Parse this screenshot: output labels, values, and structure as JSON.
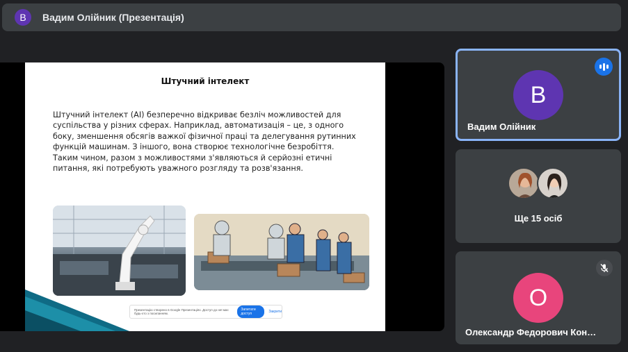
{
  "header": {
    "avatar_letter": "В",
    "title": "Вадим Олійник (Презентація)"
  },
  "slide": {
    "title": "Штучний інтелект",
    "body": "Штучний інтелект (АІ) безперечно відкриває безліч можливостей для суспільства у різних сферах. Наприклад, автоматизація – це, з одного боку, зменшення обсягів важкої фізичної праці та делегування рутинних функцій машинам. З іншого, вона створює технологічне безробіття. Таким чином, разом з можливостями з'являються й серйозні етичні питання, які потребують уважного розгляду та розв'язання.",
    "banner_text": "Презентацію створено в Google Презентаціях. Доступ до неї має будь-хто з посиланням.",
    "banner_button": "Запитати доступ",
    "banner_link": "Закрити"
  },
  "participants": [
    {
      "avatar_letter": "В",
      "name": "Вадим Олійник",
      "avatar_color": "#5e35b1",
      "speaking": true
    },
    {
      "label": "Ще 15 осіб"
    },
    {
      "avatar_letter": "О",
      "name": "Олександр Федорович Кон…",
      "avatar_color": "#e8457c",
      "muted": true
    }
  ],
  "colors": {
    "background": "#202124",
    "tile": "#3c4043",
    "active_border": "#8ab4f8",
    "speaking_badge": "#1a73e8"
  }
}
